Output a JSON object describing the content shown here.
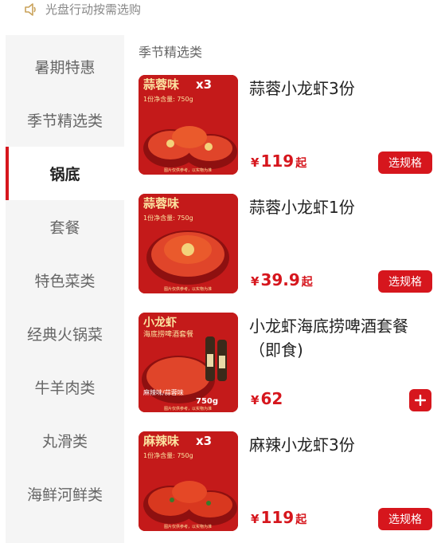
{
  "notice": {
    "icon": "speaker-icon",
    "text": "光盘行动按需选购"
  },
  "sidebar": {
    "items": [
      {
        "label": "暑期特惠"
      },
      {
        "label": "季节精选类"
      },
      {
        "label": "锅底"
      },
      {
        "label": "套餐"
      },
      {
        "label": "特色菜类"
      },
      {
        "label": "经典火锅菜"
      },
      {
        "label": "牛羊肉类"
      },
      {
        "label": "丸滑类"
      },
      {
        "label": "海鲜河鲜类"
      }
    ],
    "active_index": 2
  },
  "main": {
    "section_title": "季节精选类",
    "products": [
      {
        "name": "蒜蓉小龙虾3份",
        "currency": "¥",
        "price": "119",
        "suffix": "起",
        "action": "选规格",
        "thumb": {
          "flavor": "蒜蓉味",
          "multiplier": "x3",
          "weight_label": "1份净含量: 750g",
          "footer": "图片仅供参考，以实物为准"
        }
      },
      {
        "name": "蒜蓉小龙虾1份",
        "currency": "¥",
        "price": "39.9",
        "suffix": "起",
        "action": "选规格",
        "thumb": {
          "flavor": "蒜蓉味",
          "multiplier": "",
          "weight_label": "1份净含量: 750g",
          "footer": "图片仅供参考，以实物为准"
        }
      },
      {
        "name": "小龙虾海底捞啤酒套餐（即食)",
        "currency": "¥",
        "price": "62",
        "suffix": "",
        "action": "+",
        "thumb": {
          "flavor": "小龙虾",
          "subtitle": "海底捞啤酒套餐",
          "taste": "麻辣味/蒜蓉味",
          "weight": "750g",
          "footer": "图片仅供参考，以实物为准"
        }
      },
      {
        "name": "麻辣小龙虾3份",
        "currency": "¥",
        "price": "119",
        "suffix": "起",
        "action": "选规格",
        "thumb": {
          "flavor": "麻辣味",
          "multiplier": "x3",
          "weight_label": "1份净含量: 750g",
          "footer": "图片仅供参考，以实物为准"
        }
      }
    ]
  },
  "colors": {
    "accent": "#d6161d",
    "sidebar_bg": "#f5f5f5",
    "thumb_bg": "#c41a1a"
  }
}
